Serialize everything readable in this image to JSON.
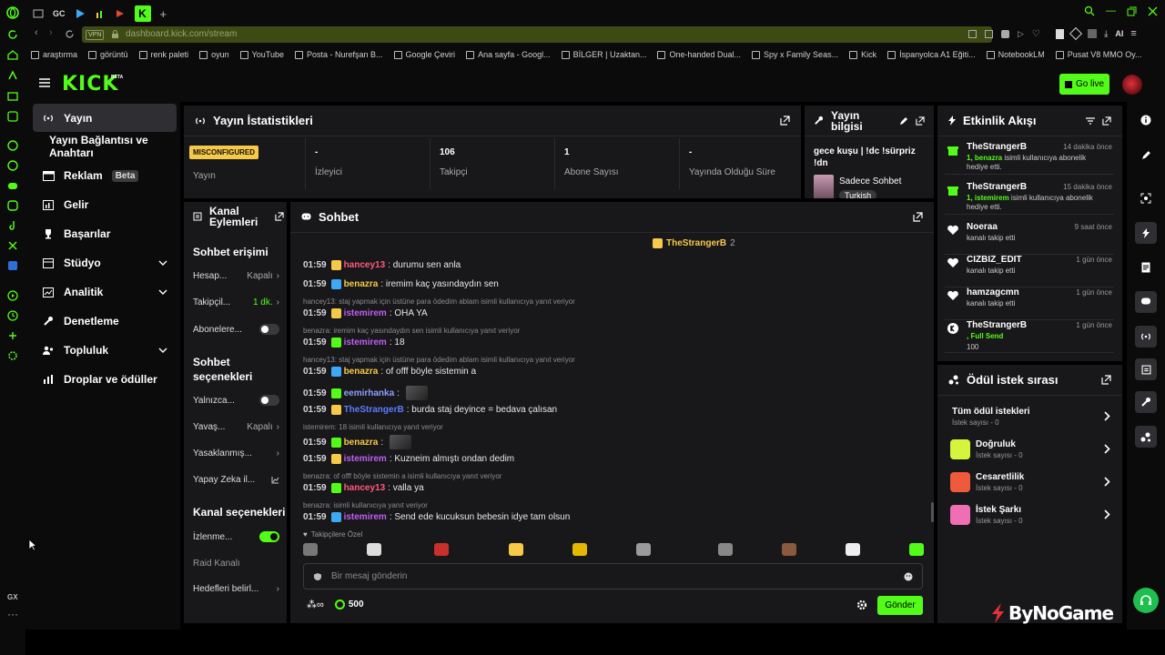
{
  "browser": {
    "tabs": [
      "GC"
    ],
    "url": "dashboard.kick.com/stream",
    "vpn": "VPN",
    "ai_label": "AI",
    "bookmarks": [
      "araştırma",
      "görüntü",
      "renk paleti",
      "oyun",
      "YouTube",
      "Posta - Nurefşan B...",
      "Google Çeviri",
      "Ana sayfa - Googl...",
      "BİLGER | Uzaktan...",
      "One-handed Dual...",
      "Spy x Family Seas...",
      "Kick",
      "İspanyolca A1 Eğiti...",
      "NotebookLM",
      "Pusat V8 MMO Oy..."
    ],
    "gx_label": "GX"
  },
  "header": {
    "logo": "KICK",
    "logo_tag": "BETA",
    "go_live": "Go live"
  },
  "nav": {
    "items": [
      {
        "label": "Yayın",
        "icon": "broadcast-icon"
      },
      {
        "label": "Yayın Bağlantısı ve Anahtarı"
      },
      {
        "label": "Reklam",
        "badge": "Beta",
        "icon": "ad-icon"
      },
      {
        "label": "Gelir",
        "icon": "chart-bar-icon"
      },
      {
        "label": "Başarılar",
        "icon": "trophy-icon"
      },
      {
        "label": "Stüdyo",
        "icon": "studio-icon"
      },
      {
        "label": "Analitik",
        "icon": "analytics-icon"
      },
      {
        "label": "Denetleme",
        "icon": "wrench-icon"
      },
      {
        "label": "Topluluk",
        "icon": "community-icon"
      },
      {
        "label": "Droplar ve ödüller",
        "icon": "drops-icon"
      }
    ]
  },
  "stats": {
    "title": "Yayın İstatistikleri",
    "status_badge": "MISCONFIGURED",
    "items": [
      {
        "value": "",
        "label": "Yayın"
      },
      {
        "value": "-",
        "label": "İzleyici"
      },
      {
        "value": "106",
        "label": "Takipçi"
      },
      {
        "value": "1",
        "label": "Abone Sayısı"
      },
      {
        "value": "-",
        "label": "Yayında Olduğu Süre"
      }
    ]
  },
  "stream_info": {
    "title": "Yayın bilgisi",
    "stream_title": "gece kuşu | !dc !sürpriz !dn",
    "category": "Sadece Sohbet",
    "language": "Turkish"
  },
  "channel_actions": {
    "title": "Kanal Eylemleri",
    "chat_access_title": "Sohbet erişimi",
    "rows_access": [
      {
        "label": "Hesap...",
        "value": "Kapalı"
      },
      {
        "label": "Takipçil...",
        "value": "1 dk."
      },
      {
        "label": "Abonelere...",
        "value": ""
      }
    ],
    "chat_options_title": "Sohbet seçenekleri",
    "rows_options": [
      {
        "label": "Yalnızca...",
        "value": ""
      },
      {
        "label": "Yavaş...",
        "value": "Kapalı"
      },
      {
        "label": "Yasaklanmış...",
        "value": ""
      },
      {
        "label": "Yapay Zeka il...",
        "value": ""
      }
    ],
    "channel_options_title": "Kanal seçenekleri",
    "rows_channel": [
      {
        "label": "İzlenme..."
      },
      {
        "label": "Raid Kanalı"
      },
      {
        "label": "Hedefleri belirl..."
      }
    ]
  },
  "chat": {
    "title": "Sohbet",
    "pinned_user": "TheStrangerB",
    "pinned_count": "2",
    "messages": [
      {
        "time": "01:59",
        "user": "hancey13",
        "color": "#ff5a7a",
        "text": ": durumu sen anla"
      },
      {
        "time": "01:59",
        "user": "benazra",
        "color": "#f7c948",
        "text": ": iremim kaç yasındaydın sen"
      },
      {
        "reply": "hancey13: staj yapmak için üstüne para ödedim ablam isimli kullanıcıya yanıt veriyor"
      },
      {
        "time": "01:59",
        "user": "istemirem",
        "color": "#c35cf3",
        "text": ": OHA YA"
      },
      {
        "reply": "benazra: iremim kaç yasındaydın sen isimli kullanıcıya yanıt veriyor"
      },
      {
        "time": "01:59",
        "user": "istemirem",
        "color": "#c35cf3",
        "text": ": 18"
      },
      {
        "reply": "hancey13: staj yapmak için üstüne para ödedim ablam isimli kullanıcıya yanıt veriyor"
      },
      {
        "time": "01:59",
        "user": "benazra",
        "color": "#f7c948",
        "text": ": of offf böyle sistemin a"
      },
      {
        "time": "01:59",
        "user": "eemirhanka",
        "color": "#8c9eff",
        "text": ":"
      },
      {
        "time": "01:59",
        "user": "TheStrangerB",
        "color": "#5d7bff",
        "text": ": burda staj deyince = bedava çalısan"
      },
      {
        "reply": "istemirem: 18 isimli kullanıcıya yanıt veriyor"
      },
      {
        "time": "01:59",
        "user": "benazra",
        "color": "#f7c948",
        "text": ":"
      },
      {
        "time": "01:59",
        "user": "istemirem",
        "color": "#c35cf3",
        "text": ": Kuzneim almıştı ondan dedim"
      },
      {
        "reply": "benazra: of offf böyle sistemin a isimli kullanıcıya yanıt veriyor"
      },
      {
        "time": "01:59",
        "user": "hancey13",
        "color": "#ff5a7a",
        "text": ": valla ya"
      },
      {
        "reply": "benazra: isimli kullanıcıya yanıt veriyor"
      },
      {
        "time": "01:59",
        "user": "istemirem",
        "color": "#c35cf3",
        "text": ": Send ede kucuksun bebesin idye tam olsun"
      }
    ],
    "followers_only": "Takipçilere Özel",
    "input_placeholder": "Bir mesaj gönderin",
    "points": "500",
    "send": "Gönder"
  },
  "activity": {
    "title": "Etkinlik Akışı",
    "items": [
      {
        "name": "TheStrangerB",
        "time": "14 dakika önce",
        "hl": "1, benazra",
        "desc": " isimli kullanıcıya abonelik hediye etti.",
        "icon": "gift-icon"
      },
      {
        "name": "TheStrangerB",
        "time": "15 dakika önce",
        "hl": "1, istemirem",
        "desc": " isimli kullanıcıya abonelik hediye etti.",
        "icon": "gift-icon"
      },
      {
        "name": "Noeraa",
        "time": "9 saat önce",
        "hl": "",
        "desc": "kanalı takip etti",
        "icon": "heart-icon"
      },
      {
        "name": "CIZBIZ_EDIT",
        "time": "1 gün önce",
        "hl": "",
        "desc": "kanalı takip etti",
        "icon": "heart-icon"
      },
      {
        "name": "hamzagcmn",
        "time": "1 gün önce",
        "hl": "",
        "desc": "kanalı takip etti",
        "icon": "heart-icon"
      },
      {
        "name": "TheStrangerB",
        "time": "1 gün önce",
        "hl": ", Full Send",
        "desc": "",
        "extra": "100",
        "icon": "kick-icon"
      }
    ]
  },
  "rewards": {
    "title": "Ödül istek sırası",
    "all": "Tüm ödül istekleri",
    "all_count": "İstek sayısı - 0",
    "items": [
      {
        "name": "Doğruluk",
        "count": "İstek sayısı - 0",
        "color": "#d4f53c"
      },
      {
        "name": "Cesaretlilik",
        "count": "İstek sayısı - 0",
        "color": "#f05a3c"
      },
      {
        "name": "İstek Şarkı",
        "count": "İstek sayısı - 0",
        "color": "#f06fb4"
      }
    ]
  },
  "watermark": "ByNoGame"
}
